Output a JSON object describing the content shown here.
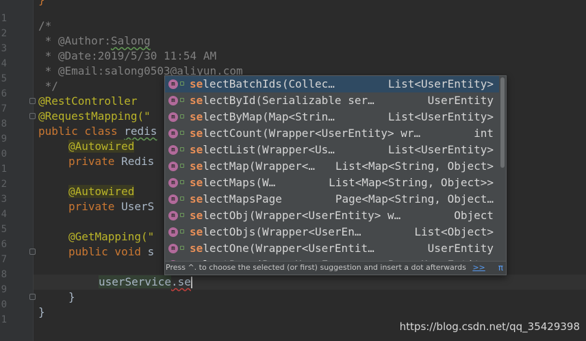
{
  "editor": {
    "line_numbers": [
      "",
      "1",
      "2",
      "3",
      "4",
      "5",
      "6",
      "7",
      "8",
      "9",
      "0",
      "1",
      "2",
      "3",
      "4",
      "5",
      "6",
      "7",
      "8",
      "9",
      "0"
    ],
    "lines": {
      "top_partial": "}",
      "comment_open": "/*",
      "author_prefix": " * @Author:",
      "author_name": "Salong",
      "date": " * @Date:2019/5/30 11:54 AM",
      "email": " * @Email:salong0503@aliyun.com",
      "comment_close": " */",
      "rest_controller": "@RestController",
      "request_mapping": "@RequestMapping(\"",
      "class_kw": "public class ",
      "class_name": "redis",
      "autowired_1": "@Autowired",
      "field_1_kw": "private ",
      "field_1_type": "Redis",
      "autowired_2": "@Autowired",
      "field_2_kw": "private ",
      "field_2_type": "UserS",
      "get_mapping": "@GetMapping(\"",
      "method_kw": "public void ",
      "method_name": "s",
      "service_ident": "userService",
      "service_rest": ".se",
      "close_method": "}",
      "close_class": "}"
    }
  },
  "completion": {
    "items": [
      {
        "match": "se",
        "rest": "lectBatchIds(Collec…",
        "type": "List<UserEntity>",
        "selected": true
      },
      {
        "match": "se",
        "rest": "lectById(Serializable ser…",
        "type": "UserEntity"
      },
      {
        "match": "se",
        "rest": "lectByMap(Map<Strin…",
        "type": "List<UserEntity>"
      },
      {
        "match": "se",
        "rest": "lectCount(Wrapper<UserEntity> wr…",
        "type": "int"
      },
      {
        "match": "se",
        "rest": "lectList(Wrapper<Us…",
        "type": "List<UserEntity>"
      },
      {
        "match": "se",
        "rest": "lectMap(Wrapper<…",
        "type": "List<Map<String, Object>"
      },
      {
        "match": "se",
        "rest": "lectMaps(W…",
        "type": "List<Map<String, Object>>"
      },
      {
        "match": "se",
        "rest": "lectMapsPage",
        "type": "Page<Map<String, Object…"
      },
      {
        "match": "se",
        "rest": "lectObj(Wrapper<UserEntity> w…",
        "type": "Object"
      },
      {
        "match": "se",
        "rest": "lectObjs(Wrapper<UserEn…",
        "type": "List<Object>"
      },
      {
        "match": "se",
        "rest": "lectOne(Wrapper<UserEntit…",
        "type": "UserEntity"
      },
      {
        "match": "se",
        "rest": "lectPage(Page<UserE…",
        "type": "Page<UserEntity>"
      }
    ],
    "footer_text": "Press ^. to choose the selected (or first) suggestion and insert a dot afterwards",
    "footer_more": ">>",
    "footer_pi": "π"
  },
  "watermark": "https://blog.csdn.net/qq_35429398",
  "colors": {
    "background": "#2b2b2b",
    "gutter": "#313335",
    "keyword": "#cc7832",
    "annotation": "#bbb529",
    "comment": "#808080",
    "match_highlight": "#e88f58",
    "link": "#589df6"
  }
}
